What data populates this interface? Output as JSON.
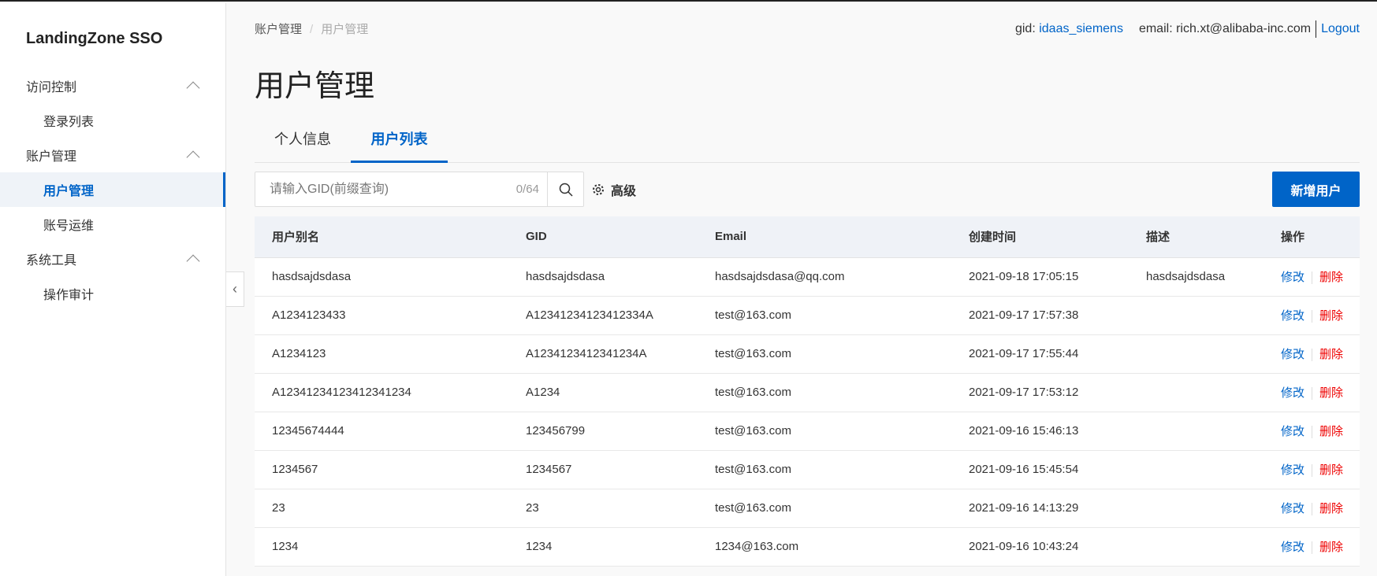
{
  "app": {
    "title": "LandingZone SSO"
  },
  "sidebar": {
    "items": [
      {
        "label": "访问控制",
        "type": "group"
      },
      {
        "label": "登录列表",
        "type": "sub"
      },
      {
        "label": "账户管理",
        "type": "group"
      },
      {
        "label": "用户管理",
        "type": "sub",
        "active": true
      },
      {
        "label": "账号运维",
        "type": "sub"
      },
      {
        "label": "系统工具",
        "type": "group"
      },
      {
        "label": "操作审计",
        "type": "sub"
      }
    ]
  },
  "breadcrumb": {
    "parent": "账户管理",
    "sep": "/",
    "current": "用户管理"
  },
  "header": {
    "gid_label": "gid:",
    "gid": "idaas_siemens",
    "email_label": "email:",
    "email": "rich.xt@alibaba-inc.com",
    "logout": "Logout"
  },
  "page": {
    "title": "用户管理"
  },
  "tabs": [
    {
      "label": "个人信息"
    },
    {
      "label": "用户列表",
      "active": true
    }
  ],
  "search": {
    "placeholder": "请输入GID(前缀查询)",
    "value": "",
    "count": "0/64"
  },
  "toolbar": {
    "advanced": "高级",
    "add_user": "新增用户"
  },
  "colors": {
    "accent": "#0064c8",
    "danger": "#ee0000"
  },
  "table": {
    "columns": [
      "用户别名",
      "GID",
      "Email",
      "创建时间",
      "描述",
      "操作"
    ],
    "edit_label": "修改",
    "delete_label": "删除",
    "rows": [
      [
        "hasdsajdsdasa",
        "hasdsajdsdasa",
        "hasdsajdsdasa@qq.com",
        "2021-09-18 17:05:15",
        "hasdsajdsdasa"
      ],
      [
        "A1234123433",
        "A12341234123412334A",
        "test@163.com",
        "2021-09-17 17:57:38",
        ""
      ],
      [
        "A1234123",
        "A1234123412341234A",
        "test@163.com",
        "2021-09-17 17:55:44",
        ""
      ],
      [
        "A12341234123412341234",
        "A1234",
        "test@163.com",
        "2021-09-17 17:53:12",
        ""
      ],
      [
        "12345674444",
        "123456799",
        "test@163.com",
        "2021-09-16 15:46:13",
        ""
      ],
      [
        "1234567",
        "1234567",
        "test@163.com",
        "2021-09-16 15:45:54",
        ""
      ],
      [
        "23",
        "23",
        "test@163.com",
        "2021-09-16 14:13:29",
        ""
      ],
      [
        "1234",
        "1234",
        "1234@163.com",
        "2021-09-16 10:43:24",
        ""
      ]
    ]
  }
}
